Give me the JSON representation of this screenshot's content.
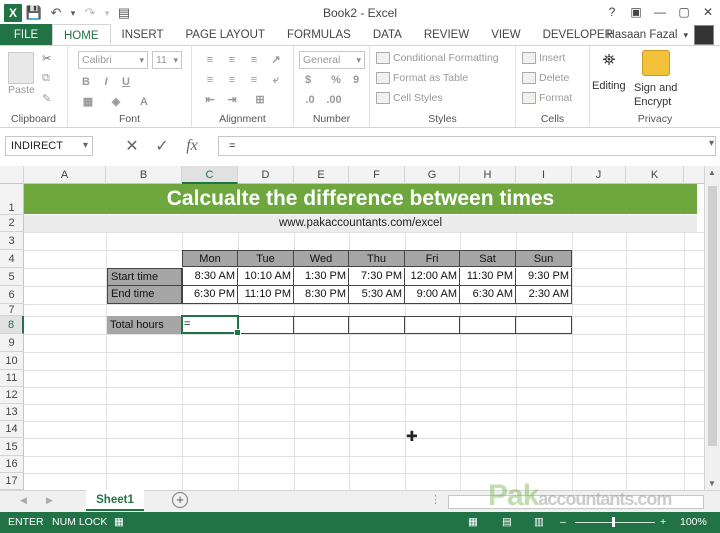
{
  "window": {
    "title": "Book2 - Excel",
    "controls": [
      "?",
      "▣",
      "—",
      "▢",
      "✕"
    ]
  },
  "tabs": [
    "FILE",
    "HOME",
    "INSERT",
    "PAGE LAYOUT",
    "FORMULAS",
    "DATA",
    "REVIEW",
    "VIEW",
    "DEVELOPER"
  ],
  "active_tab": "HOME",
  "user": {
    "name": "Hasaan Fazal"
  },
  "ribbon": {
    "clipboard": {
      "label": "Clipboard",
      "paste": "Paste"
    },
    "font": {
      "label": "Font",
      "name": "Calibri",
      "size": "11",
      "bold": "B",
      "italic": "I",
      "underline": "U"
    },
    "alignment": {
      "label": "Alignment"
    },
    "number": {
      "label": "Number",
      "format": "General",
      "currency": "$",
      "percent": "%",
      "comma": "9"
    },
    "styles": {
      "label": "Styles",
      "conditional": "Conditional Formatting",
      "table": "Format as Table",
      "cell_styles": "Cell Styles"
    },
    "cells": {
      "label": "Cells",
      "insert": "Insert",
      "delete": "Delete",
      "format": "Format"
    },
    "editing": {
      "label": "Editing"
    },
    "privacy": {
      "label": "Privacy",
      "sign": "Sign and",
      "encrypt": "Encrypt"
    }
  },
  "formula_bar": {
    "name_box": "INDIRECT",
    "formula": "=",
    "fx": "fx"
  },
  "columns": [
    "A",
    "B",
    "C",
    "D",
    "E",
    "F",
    "G",
    "H",
    "I",
    "J",
    "K"
  ],
  "selected_column": "C",
  "rows": [
    "1",
    "2",
    "3",
    "4",
    "5",
    "6",
    "7",
    "8",
    "9",
    "10",
    "11",
    "12",
    "13",
    "14",
    "15",
    "16",
    "17"
  ],
  "selected_row": "8",
  "sheet": {
    "banner": "Calcualte the difference between times",
    "website": "www.pakaccountants.com/excel",
    "days": [
      "Mon",
      "Tue",
      "Wed",
      "Thu",
      "Fri",
      "Sat",
      "Sun"
    ],
    "start_label": "Start time",
    "end_label": "End time",
    "total_label": "Total hours",
    "start_times": [
      "8:30 AM",
      "10:10 AM",
      "1:30 PM",
      "7:30 PM",
      "12:00 AM",
      "11:30 PM",
      "9:30 PM"
    ],
    "end_times": [
      "6:30 PM",
      "11:10 PM",
      "8:30 PM",
      "5:30 AM",
      "9:00 AM",
      "6:30 AM",
      "2:30 AM"
    ],
    "active_cell_text": "="
  },
  "sheet_tabs": [
    "Sheet1"
  ],
  "watermark": {
    "pak": "Pak",
    "rest": "accountants.com"
  },
  "status": {
    "mode": "ENTER",
    "numlock": "NUM LOCK",
    "zoom": "100%"
  }
}
